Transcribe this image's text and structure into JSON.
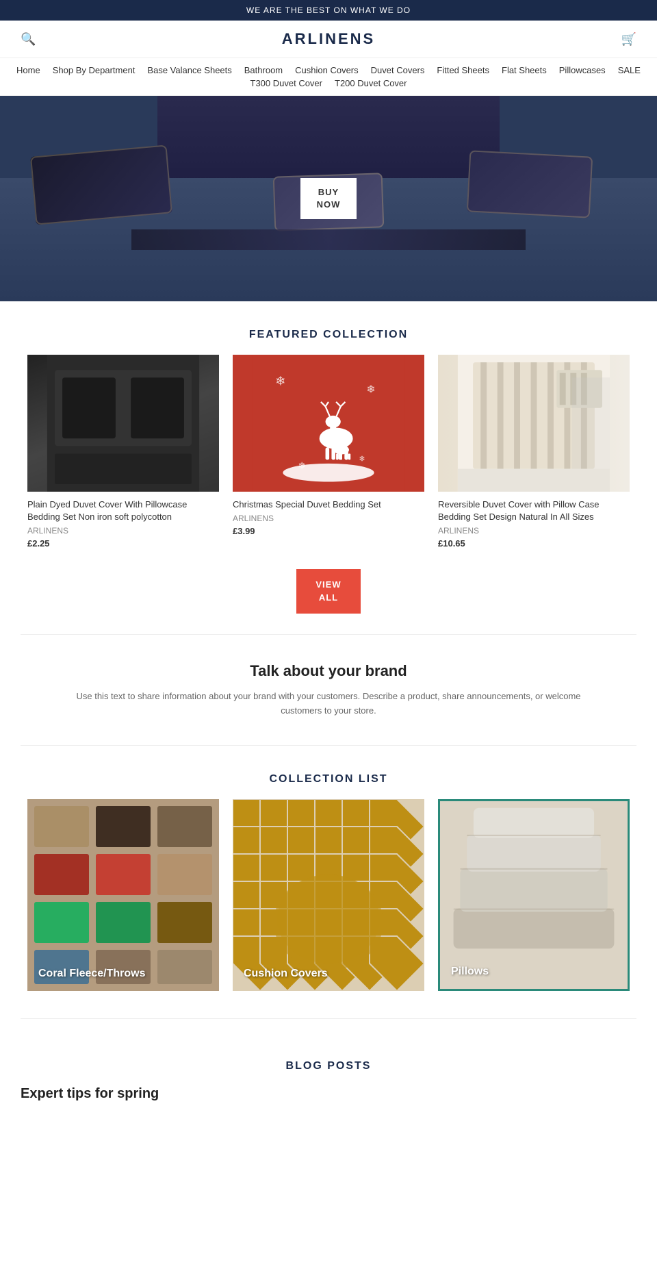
{
  "topBanner": {
    "text": "WE ARE THE BEST ON WHAT WE DO"
  },
  "header": {
    "logo": "ARLINENS",
    "searchIcon": "🔍",
    "cartIcon": "🛒"
  },
  "nav": {
    "items": [
      {
        "label": "Home",
        "href": "#"
      },
      {
        "label": "Shop By Department",
        "href": "#"
      },
      {
        "label": "Base Valance Sheets",
        "href": "#"
      },
      {
        "label": "Bathroom",
        "href": "#"
      },
      {
        "label": "Cushion Covers",
        "href": "#"
      },
      {
        "label": "Duvet Covers",
        "href": "#"
      },
      {
        "label": "Fitted Sheets",
        "href": "#"
      },
      {
        "label": "Flat Sheets",
        "href": "#"
      },
      {
        "label": "Pillowcases",
        "href": "#"
      },
      {
        "label": "SALE",
        "href": "#"
      },
      {
        "label": "T300 Duvet Cover",
        "href": "#"
      },
      {
        "label": "T200 Duvet Cover",
        "href": "#"
      }
    ]
  },
  "hero": {
    "buyNowLabel": "BUY\nNOW"
  },
  "featuredCollection": {
    "title": "FEATURED COLLECTION",
    "products": [
      {
        "name": "Plain Dyed Duvet Cover With Pillowcase Bedding Set Non iron soft polycotton",
        "brand": "ARLINENS",
        "price": "£2.25"
      },
      {
        "name": "Christmas Special Duvet Bedding Set",
        "brand": "ARLINENS",
        "price": "£3.99"
      },
      {
        "name": "Reversible Duvet Cover with Pillow Case Bedding Set Design Natural In All Sizes",
        "brand": "ARLINENS",
        "price": "£10.65"
      }
    ],
    "viewAllLabel": "VIEW\nALL"
  },
  "brandSection": {
    "title": "Talk about your brand",
    "text": "Use this text to share information about your brand with your customers. Describe a product, share announcements, or welcome customers to your store."
  },
  "collectionList": {
    "title": "COLLECTION LIST",
    "items": [
      {
        "label": "Coral Fleece/Throws"
      },
      {
        "label": "Cushion Covers"
      },
      {
        "label": "Pillows"
      }
    ]
  },
  "blogPosts": {
    "title": "BLOG POSTS",
    "firstPost": {
      "title": "Expert tips for spring"
    }
  }
}
